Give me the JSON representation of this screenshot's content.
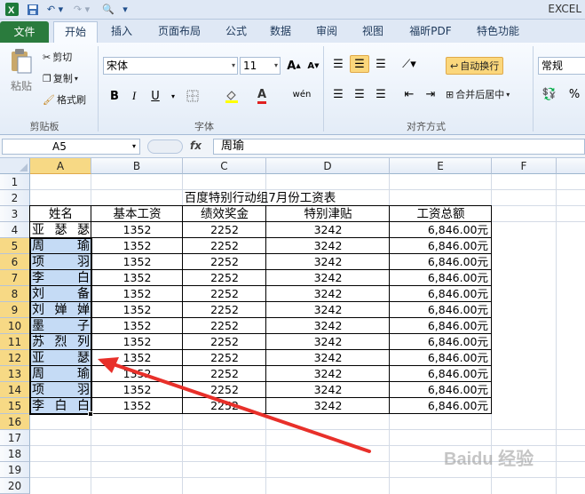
{
  "app": {
    "title": "EXCEL"
  },
  "tabs": [
    "文件",
    "开始",
    "插入",
    "页面布局",
    "公式",
    "数据",
    "审阅",
    "视图",
    "福昕PDF",
    "特色功能"
  ],
  "clipboard": {
    "paste": "粘贴",
    "cut": "剪切",
    "copy": "复制",
    "format_painter": "格式刷",
    "group": "剪贴板"
  },
  "font": {
    "name": "宋体",
    "size": "11",
    "bold": "B",
    "italic": "I",
    "underline": "U",
    "group": "字体",
    "wen": "wén"
  },
  "alignment": {
    "wrap": "自动换行",
    "merge": "合并后居中",
    "group": "对齐方式"
  },
  "number": {
    "format": "常规",
    "percent": "%"
  },
  "formula_bar": {
    "name_box": "A5",
    "fx": "fx",
    "content": "周瑜"
  },
  "sheet": {
    "columns": [
      "A",
      "B",
      "C",
      "D",
      "E",
      "F"
    ],
    "rows": [
      "1",
      "2",
      "3",
      "4",
      "5",
      "6",
      "7",
      "8",
      "9",
      "10",
      "11",
      "12",
      "13",
      "14",
      "15",
      "16",
      "17",
      "18",
      "19",
      "20"
    ],
    "title": "百度特别行动组7月份工资表",
    "headers": [
      "姓名",
      "基本工资",
      "绩效奖金",
      "特别津贴",
      "工资总额"
    ],
    "data": [
      [
        "亚瑟瑟",
        "1352",
        "2252",
        "3242",
        "6,846.00元"
      ],
      [
        "周瑜",
        "1352",
        "2252",
        "3242",
        "6,846.00元"
      ],
      [
        "项羽",
        "1352",
        "2252",
        "3242",
        "6,846.00元"
      ],
      [
        "李白",
        "1352",
        "2252",
        "3242",
        "6,846.00元"
      ],
      [
        "刘备",
        "1352",
        "2252",
        "3242",
        "6,846.00元"
      ],
      [
        "刘婵婵",
        "1352",
        "2252",
        "3242",
        "6,846.00元"
      ],
      [
        "墨子",
        "1352",
        "2252",
        "3242",
        "6,846.00元"
      ],
      [
        "苏烈列",
        "1352",
        "2252",
        "3242",
        "6,846.00元"
      ],
      [
        "亚瑟",
        "1352",
        "2252",
        "3242",
        "6,846.00元"
      ],
      [
        "周瑜",
        "1352",
        "2252",
        "3242",
        "6,846.00元"
      ],
      [
        "项羽",
        "1352",
        "2252",
        "3242",
        "6,846.00元"
      ],
      [
        "李白白",
        "1352",
        "2252",
        "3242",
        "6,846.00元"
      ]
    ]
  },
  "watermark": "Baidu 经验",
  "colors": {
    "file_tab": "#2a7b3d",
    "selection": "#c5dbf5",
    "annotation_arrow": "#e8302a"
  }
}
